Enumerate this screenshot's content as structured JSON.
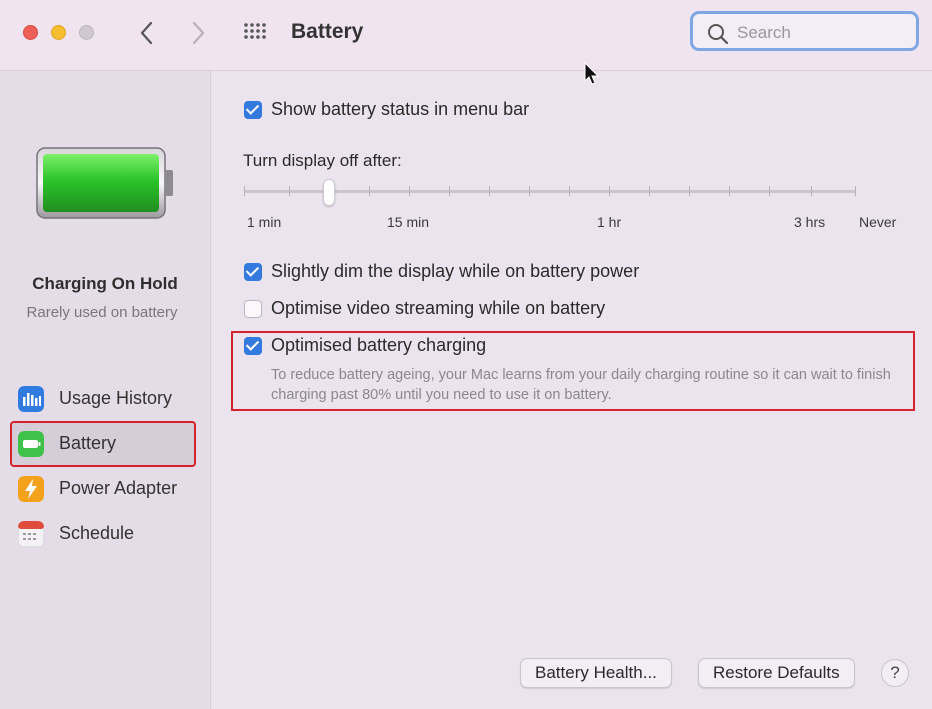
{
  "window": {
    "title": "Battery",
    "search_placeholder": "Search"
  },
  "sidebar": {
    "status_title": "Charging On Hold",
    "status_subtitle": "Rarely used on battery",
    "items": [
      {
        "label": "Usage History",
        "icon": "bar-chart-icon",
        "color": "#2f7be0"
      },
      {
        "label": "Battery",
        "icon": "battery-icon",
        "color": "#3ec24a",
        "selected": true
      },
      {
        "label": "Power Adapter",
        "icon": "lightning-icon",
        "color": "#f4a21c"
      },
      {
        "label": "Schedule",
        "icon": "calendar-icon",
        "color": "#e04b3c"
      }
    ]
  },
  "settings": {
    "show_status": {
      "label": "Show battery status in menu bar",
      "checked": true
    },
    "display_off": {
      "label": "Turn display off after:",
      "ticks": [
        "1 min",
        "15 min",
        "1 hr",
        "3 hrs",
        "Never"
      ],
      "value": "3 min"
    },
    "dim_display": {
      "label": "Slightly dim the display while on battery power",
      "checked": true
    },
    "video_streaming": {
      "label": "Optimise video streaming while on battery",
      "checked": false
    },
    "optimised_charging": {
      "label": "Optimised battery charging",
      "checked": true,
      "description": "To reduce battery ageing, your Mac learns from your daily charging routine so it can wait to finish charging past 80% until you need to use it on battery."
    }
  },
  "buttons": {
    "battery_health": "Battery Health...",
    "restore_defaults": "Restore Defaults",
    "help": "?"
  },
  "colors": {
    "accent": "#3479de",
    "highlight": "#d3232c",
    "battery_green": "#3ec24a"
  }
}
